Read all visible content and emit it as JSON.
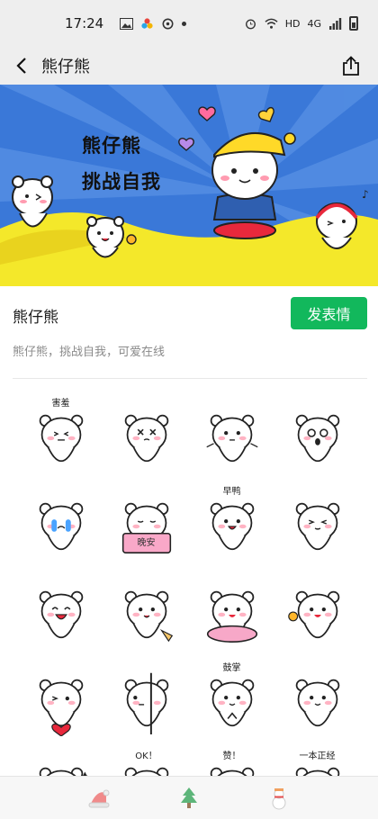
{
  "status_bar": {
    "time": "17:24",
    "network": "4G",
    "hd": "HD"
  },
  "nav": {
    "title": "熊仔熊"
  },
  "banner": {
    "line1": "熊仔熊",
    "line2": "挑战自我"
  },
  "pack": {
    "name": "熊仔熊",
    "add_label": "发表情",
    "description": "熊仔熊，挑战自我，可爱在线"
  },
  "stickers": [
    {
      "icon": "bear-shy-icon",
      "caption": "害羞"
    },
    {
      "icon": "bear-dizzy-icon",
      "caption": ""
    },
    {
      "icon": "bear-shrug-icon",
      "caption": ""
    },
    {
      "icon": "bear-shocked-icon",
      "caption": ""
    },
    {
      "icon": "bear-crying-icon",
      "caption": ""
    },
    {
      "icon": "bear-goodnight-icon",
      "caption": "晚安"
    },
    {
      "icon": "bear-morning-icon",
      "caption": "早鸭"
    },
    {
      "icon": "bear-blush-icon",
      "caption": ""
    },
    {
      "icon": "bear-laugh-icon",
      "caption": ""
    },
    {
      "icon": "bear-dance-icon",
      "caption": ""
    },
    {
      "icon": "bear-donut-icon",
      "caption": ""
    },
    {
      "icon": "bear-flower-icon",
      "caption": ""
    },
    {
      "icon": "bear-heart-icon",
      "caption": ""
    },
    {
      "icon": "bear-peek-icon",
      "caption": ""
    },
    {
      "icon": "bear-clap-icon",
      "caption": "鼓掌"
    },
    {
      "icon": "bear-lying-icon",
      "caption": ""
    },
    {
      "icon": "bear-sparkle-icon",
      "caption": ""
    },
    {
      "icon": "bear-ok-icon",
      "caption": "OK！"
    },
    {
      "icon": "bear-like-icon",
      "caption": "赞！"
    },
    {
      "icon": "bear-serious-icon",
      "caption": "一本正经"
    }
  ],
  "tabs": [
    {
      "icon": "santa-hat-icon"
    },
    {
      "icon": "christmas-tree-icon"
    },
    {
      "icon": "snowman-icon"
    }
  ],
  "colors": {
    "accent": "#12b85c",
    "banner_blue": "#3a78d8",
    "banner_yellow": "#f4e82a"
  }
}
